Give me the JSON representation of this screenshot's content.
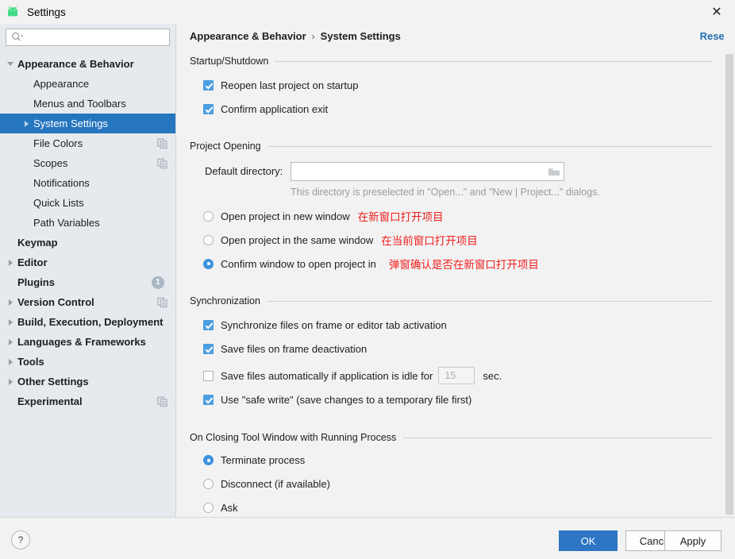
{
  "window": {
    "title": "Settings",
    "logo_icon": "android-logo-icon",
    "close_icon": "close-icon",
    "close_glyph": "✕"
  },
  "sidebar": {
    "search": {
      "value": "",
      "placeholder": "",
      "icon": "search-icon"
    },
    "items": [
      {
        "label": "Appearance & Behavior",
        "level": 0,
        "bold": true,
        "twisty": "down",
        "selected": false,
        "badge": "",
        "copy_icon": false
      },
      {
        "label": "Appearance",
        "level": 1,
        "bold": false,
        "twisty": "none",
        "selected": false,
        "badge": "",
        "copy_icon": false
      },
      {
        "label": "Menus and Toolbars",
        "level": 1,
        "bold": false,
        "twisty": "none",
        "selected": false,
        "badge": "",
        "copy_icon": false
      },
      {
        "label": "System Settings",
        "level": 1,
        "bold": false,
        "twisty": "right",
        "selected": true,
        "badge": "",
        "copy_icon": false
      },
      {
        "label": "File Colors",
        "level": 1,
        "bold": false,
        "twisty": "none",
        "selected": false,
        "badge": "",
        "copy_icon": true
      },
      {
        "label": "Scopes",
        "level": 1,
        "bold": false,
        "twisty": "none",
        "selected": false,
        "badge": "",
        "copy_icon": true
      },
      {
        "label": "Notifications",
        "level": 1,
        "bold": false,
        "twisty": "none",
        "selected": false,
        "badge": "",
        "copy_icon": false
      },
      {
        "label": "Quick Lists",
        "level": 1,
        "bold": false,
        "twisty": "none",
        "selected": false,
        "badge": "",
        "copy_icon": false
      },
      {
        "label": "Path Variables",
        "level": 1,
        "bold": false,
        "twisty": "none",
        "selected": false,
        "badge": "",
        "copy_icon": false
      },
      {
        "label": "Keymap",
        "level": 0,
        "bold": true,
        "twisty": "none",
        "selected": false,
        "badge": "",
        "copy_icon": false
      },
      {
        "label": "Editor",
        "level": 0,
        "bold": true,
        "twisty": "right",
        "selected": false,
        "badge": "",
        "copy_icon": false
      },
      {
        "label": "Plugins",
        "level": 0,
        "bold": true,
        "twisty": "none",
        "selected": false,
        "badge": "1",
        "copy_icon": false
      },
      {
        "label": "Version Control",
        "level": 0,
        "bold": true,
        "twisty": "right",
        "selected": false,
        "badge": "",
        "copy_icon": true
      },
      {
        "label": "Build, Execution, Deployment",
        "level": 0,
        "bold": true,
        "twisty": "right",
        "selected": false,
        "badge": "",
        "copy_icon": false
      },
      {
        "label": "Languages & Frameworks",
        "level": 0,
        "bold": true,
        "twisty": "right",
        "selected": false,
        "badge": "",
        "copy_icon": false
      },
      {
        "label": "Tools",
        "level": 0,
        "bold": true,
        "twisty": "right",
        "selected": false,
        "badge": "",
        "copy_icon": false
      },
      {
        "label": "Other Settings",
        "level": 0,
        "bold": true,
        "twisty": "right",
        "selected": false,
        "badge": "",
        "copy_icon": false
      },
      {
        "label": "Experimental",
        "level": 0,
        "bold": true,
        "twisty": "none",
        "selected": false,
        "badge": "",
        "copy_icon": true
      }
    ]
  },
  "content": {
    "breadcrumb": {
      "parent": "Appearance & Behavior",
      "separator": "›",
      "current": "System Settings"
    },
    "reset_label": "Reset",
    "sections": {
      "startup": {
        "title": "Startup/Shutdown",
        "reopen_label": "Reopen last project on startup",
        "reopen_checked": true,
        "confirm_exit_label": "Confirm application exit",
        "confirm_exit_checked": true
      },
      "project_opening": {
        "title": "Project Opening",
        "default_dir_label": "Default directory:",
        "default_dir_value": "",
        "folder_icon": "folder-icon",
        "hint": "This directory is preselected in \"Open...\" and \"New | Project...\" dialogs.",
        "options": [
          {
            "label": "Open project in new window",
            "selected": false,
            "note": "在新窗口打开项目"
          },
          {
            "label": "Open project in the same window",
            "selected": false,
            "note": "在当前窗口打开项目"
          },
          {
            "label": "Confirm window to open project in",
            "selected": true,
            "note": "弹窗确认是否在新窗口打开项目"
          }
        ]
      },
      "synchronization": {
        "title": "Synchronization",
        "sync_files_label": "Synchronize files on frame or editor tab activation",
        "sync_files_checked": true,
        "save_deactivation_label": "Save files on frame deactivation",
        "save_deactivation_checked": true,
        "autosave_label": "Save files automatically if application is idle for",
        "autosave_checked": false,
        "idle_seconds": "15",
        "seconds_unit": "sec.",
        "safe_write_label": "Use \"safe write\" (save changes to a temporary file first)",
        "safe_write_checked": true
      },
      "tool_window": {
        "title": "On Closing Tool Window with Running Process",
        "options": [
          {
            "label": "Terminate process",
            "selected": true
          },
          {
            "label": "Disconnect (if available)",
            "selected": false
          },
          {
            "label": "Ask",
            "selected": false
          }
        ]
      }
    }
  },
  "footer": {
    "help_label": "?",
    "ok_label": "OK",
    "cancel_label": "Cancel",
    "apply_label": "Apply"
  },
  "colors": {
    "accent_blue": "#2675bf",
    "checkbox_blue": "#4d9ee0",
    "radio_blue": "#3d93de",
    "link_blue": "#2470b3",
    "note_red": "#f01e1e",
    "sidebar_bg": "#e6eaee",
    "content_bg": "#f2f2f2"
  }
}
